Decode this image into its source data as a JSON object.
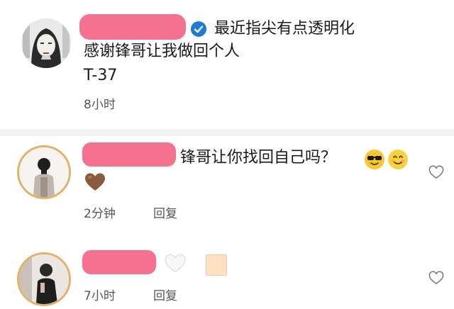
{
  "post": {
    "headline": "最近指尖有点透明化",
    "line2": "感谢锋哥让我做回个人",
    "line3": "T-37",
    "time": "8小时"
  },
  "comments": [
    {
      "text": "锋哥让你找回自己吗？",
      "emojis": [
        "smiling-face-with-sunglasses",
        "smiling-face"
      ],
      "sticker": "brown-heart",
      "time": "2分钟",
      "reply_label": "回复"
    },
    {
      "stickers": [
        "white-heart",
        "light-skin-tone-square"
      ],
      "time": "7小时",
      "reply_label": "回复"
    }
  ],
  "colors": {
    "redaction": "#f4728f",
    "verified_badge": "#1f7ad8",
    "avatar_ring": "#e0b36a"
  }
}
